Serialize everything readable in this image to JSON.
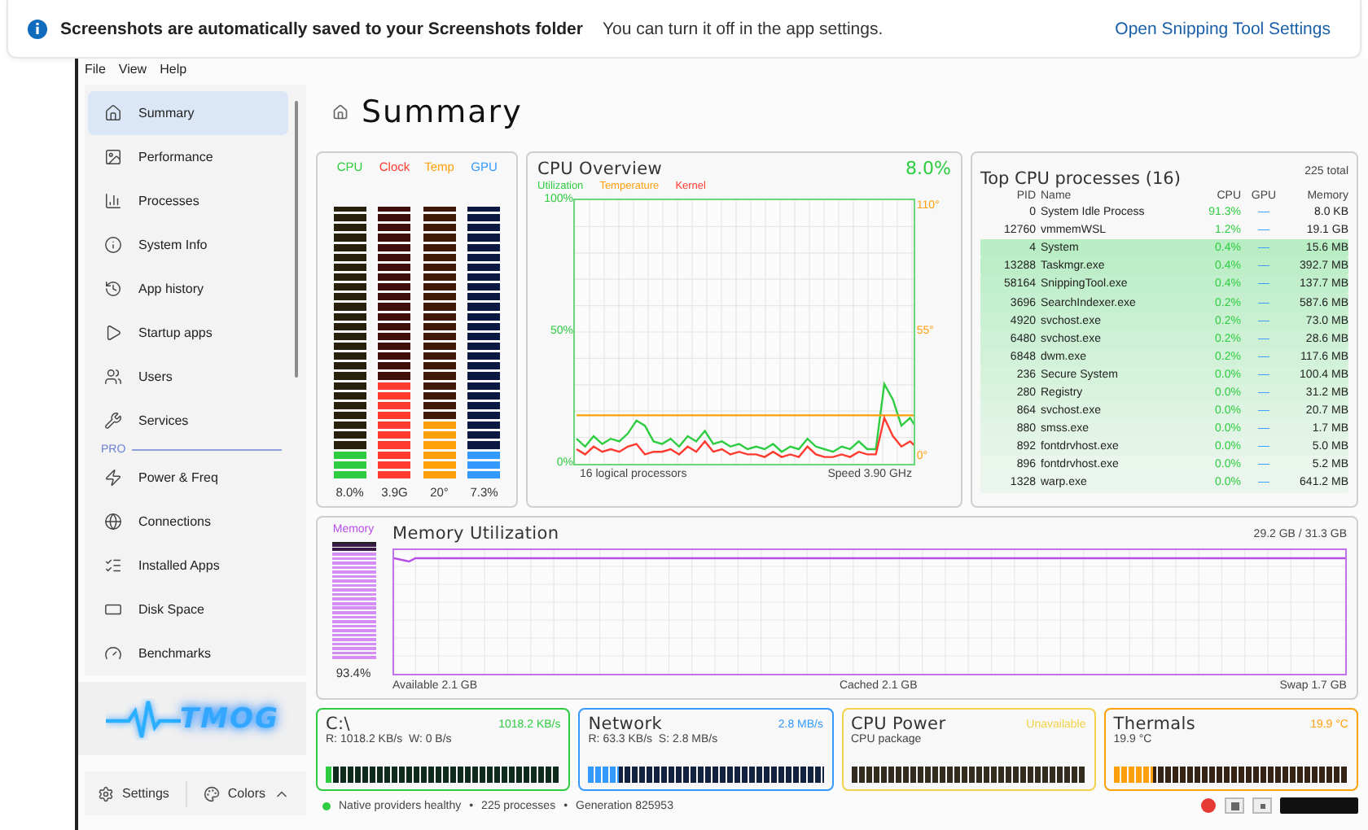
{
  "notification": {
    "title": "Screenshots are automatically saved to your Screenshots folder",
    "message": "You can turn it off in the app settings.",
    "link": "Open Snipping Tool Settings"
  },
  "menu": [
    "File",
    "View",
    "Help"
  ],
  "sidebar": {
    "groups": [
      {
        "items": [
          {
            "label": "Summary",
            "selected": true
          },
          {
            "label": "Performance",
            "selected": false
          },
          {
            "label": "Processes",
            "selected": false
          },
          {
            "label": "System Info",
            "selected": false
          },
          {
            "label": "App history",
            "selected": false
          },
          {
            "label": "Startup apps",
            "selected": false
          },
          {
            "label": "Users",
            "selected": false
          },
          {
            "label": "Services",
            "selected": false
          }
        ]
      },
      {
        "label": "PRO",
        "items": [
          {
            "label": "Power & Freq",
            "selected": false
          },
          {
            "label": "Connections",
            "selected": false
          },
          {
            "label": "Installed Apps",
            "selected": false
          },
          {
            "label": "Disk Space",
            "selected": false
          },
          {
            "label": "Benchmarks",
            "selected": false
          }
        ]
      }
    ],
    "logo": "TMOG",
    "footer": {
      "settings": "Settings",
      "colors": "Colors"
    }
  },
  "page_title": "Summary",
  "meters": [
    {
      "label": "CPU",
      "value": "8.0%",
      "level": 0.107,
      "color": "#2ecc40"
    },
    {
      "label": "Clock",
      "value": "3.9G",
      "level": 0.357,
      "color": "#ff3b30"
    },
    {
      "label": "Temp",
      "value": "20°",
      "level": 0.214,
      "color": "#ff9f0a"
    },
    {
      "label": "GPU",
      "value": "7.3%",
      "level": 0.107,
      "color": "#3399ff"
    }
  ],
  "cpu_overview": {
    "title": "CPU Overview",
    "reading": "8.0%",
    "footer_left": "16 logical processors",
    "footer_right": "Speed 3.90 GHz",
    "right_axis_labels": [
      "110°",
      "55°",
      "0°"
    ],
    "chart_data": {
      "type": "line",
      "grid": true,
      "ylim": [
        0,
        100
      ],
      "yticks": [
        {
          "value": 0,
          "label": "0%"
        },
        {
          "value": 50,
          "label": "50%"
        },
        {
          "value": 100,
          "label": "100%"
        }
      ],
      "series": [
        {
          "name": "Utilization",
          "color": "#2ecc40",
          "values": [
            9,
            6,
            10,
            7,
            9,
            8,
            11,
            16,
            14,
            8,
            7,
            9,
            6,
            10,
            8,
            12,
            7,
            8,
            6,
            7,
            5,
            6,
            5,
            7,
            4,
            6,
            5,
            9,
            6,
            5,
            4,
            6,
            5,
            8,
            5,
            5,
            30,
            24,
            14,
            17,
            12
          ]
        },
        {
          "name": "Temperature",
          "color": "#ff9f0a",
          "values": [
            18,
            18,
            18,
            18,
            18,
            18,
            18,
            18,
            18,
            18,
            18,
            18,
            18,
            18,
            18,
            18,
            18,
            18,
            18,
            18,
            18,
            18,
            18,
            18,
            18,
            18,
            18,
            18,
            18,
            18,
            18,
            18,
            18,
            18,
            18,
            18,
            18,
            18,
            18,
            18,
            18
          ]
        },
        {
          "name": "Kernel",
          "color": "#ff3b30",
          "values": [
            5,
            3,
            6,
            4,
            5,
            4,
            6,
            7,
            3,
            4,
            4,
            5,
            3,
            6,
            4,
            8,
            4,
            5,
            3,
            4,
            3,
            3,
            2,
            4,
            2,
            3,
            2,
            6,
            3,
            2,
            2,
            3,
            2,
            4,
            3,
            3,
            17,
            10,
            6,
            8,
            5
          ]
        }
      ]
    }
  },
  "processes": {
    "title": "Top CPU processes (16)",
    "total": "225 total",
    "columns": [
      "PID",
      "Name",
      "CPU",
      "GPU",
      "Memory"
    ],
    "rows": [
      {
        "pid": "0",
        "name": "System Idle Process",
        "cpu": "91.3%",
        "gpu": "—",
        "memory": "8.0 KB",
        "highlighted": false
      },
      {
        "pid": "12760",
        "name": "vmmemWSL",
        "cpu": "1.2%",
        "gpu": "—",
        "memory": "19.1 GB",
        "highlighted": false
      },
      {
        "pid": "4",
        "name": "System",
        "cpu": "0.4%",
        "gpu": "—",
        "memory": "15.6 MB",
        "highlighted": true
      },
      {
        "pid": "13288",
        "name": "Taskmgr.exe",
        "cpu": "0.4%",
        "gpu": "—",
        "memory": "392.7 MB",
        "highlighted": true
      },
      {
        "pid": "58164",
        "name": "SnippingTool.exe",
        "cpu": "0.4%",
        "gpu": "—",
        "memory": "137.7 MB",
        "highlighted": true
      },
      {
        "pid": "3696",
        "name": "SearchIndexer.exe",
        "cpu": "0.2%",
        "gpu": "—",
        "memory": "587.6 MB",
        "highlighted": true
      },
      {
        "pid": "4920",
        "name": "svchost.exe",
        "cpu": "0.2%",
        "gpu": "—",
        "memory": "73.0 MB",
        "highlighted": true
      },
      {
        "pid": "6480",
        "name": "svchost.exe",
        "cpu": "0.2%",
        "gpu": "—",
        "memory": "28.6 MB",
        "highlighted": true
      },
      {
        "pid": "6848",
        "name": "dwm.exe",
        "cpu": "0.2%",
        "gpu": "—",
        "memory": "117.6 MB",
        "highlighted": true
      },
      {
        "pid": "236",
        "name": "Secure System",
        "cpu": "0.0%",
        "gpu": "—",
        "memory": "100.4 MB",
        "highlighted": true
      },
      {
        "pid": "280",
        "name": "Registry",
        "cpu": "0.0%",
        "gpu": "—",
        "memory": "31.2 MB",
        "highlighted": true
      },
      {
        "pid": "864",
        "name": "svchost.exe",
        "cpu": "0.0%",
        "gpu": "—",
        "memory": "20.7 MB",
        "highlighted": true
      },
      {
        "pid": "880",
        "name": "smss.exe",
        "cpu": "0.0%",
        "gpu": "—",
        "memory": "1.7 MB",
        "highlighted": true
      },
      {
        "pid": "892",
        "name": "fontdrvhost.exe",
        "cpu": "0.0%",
        "gpu": "—",
        "memory": "5.0 MB",
        "highlighted": true
      },
      {
        "pid": "896",
        "name": "fontdrvhost.exe",
        "cpu": "0.0%",
        "gpu": "—",
        "memory": "5.2 MB",
        "highlighted": true
      },
      {
        "pid": "1328",
        "name": "warp.exe",
        "cpu": "0.0%",
        "gpu": "—",
        "memory": "641.2 MB",
        "highlighted": true
      }
    ]
  },
  "memory": {
    "label": "Memory",
    "title": "Memory Utilization",
    "usage": "29.2 GB / 31.3 GB",
    "level": 0.934,
    "reading": "93.4%",
    "footer": [
      "Available 2.1 GB",
      "Cached 2.1 GB",
      "Swap 1.7 GB"
    ]
  },
  "cards": [
    {
      "title": "C:\\",
      "rate": "1018.2 KB/s",
      "detail": "R: 1018.2 KB/s  W: 0 B/s",
      "level": 0.03,
      "color": "#2ecc40"
    },
    {
      "title": "Network",
      "rate": "2.8 MB/s",
      "detail": "R: 63.3 KB/s  S: 2.8 MB/s",
      "level": 0.13,
      "color": "#3399ff"
    },
    {
      "title": "CPU Power",
      "rate": "Unavailable",
      "detail": "CPU package",
      "level": 0,
      "color": "#f2d24b"
    },
    {
      "title": "Thermals",
      "rate": "19.9 °C",
      "detail": "19.9 °C",
      "level": 0.17,
      "color": "#ff9f0a"
    }
  ],
  "status": {
    "healthy": true,
    "separator": "•",
    "items": [
      "Native providers healthy",
      "225 processes",
      "Generation 825953"
    ]
  }
}
